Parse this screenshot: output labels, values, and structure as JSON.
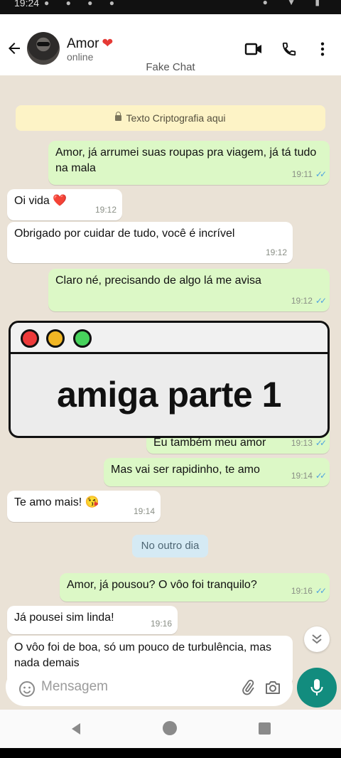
{
  "status_bar": {
    "time": "19:24"
  },
  "header": {
    "contact_name": "Amor",
    "name_emoji": "❤",
    "status": "online",
    "subtitle": "Fake Chat"
  },
  "encryption_notice": "Texto Criptografia aqui",
  "messages": [
    {
      "direction": "out",
      "text": "Amor, já arrumei suas roupas pra viagem, já tá tudo na mala",
      "time": "19:11"
    },
    {
      "direction": "in",
      "text": "Oi vida ❤️",
      "time": "19:12"
    },
    {
      "direction": "in",
      "text": "Obrigado por cuidar de tudo, você é incrível",
      "time": "19:12"
    },
    {
      "direction": "out",
      "text": "Claro né, precisando de algo lá me avisa",
      "time": "19:12"
    },
    {
      "direction": "out",
      "text": "Eu também meu amor",
      "time": "19:13"
    },
    {
      "direction": "out",
      "text": "Mas vai ser rapidinho, te amo",
      "time": "19:14"
    },
    {
      "direction": "in",
      "text": "Te amo mais! 😘",
      "time": "19:14"
    },
    {
      "direction": "out",
      "text": "Amor, já pousou? O vôo foi tranquilo?",
      "time": "19:16"
    },
    {
      "direction": "in",
      "text": "Já pousei sim linda!",
      "time": "19:16"
    },
    {
      "direction": "in",
      "text": "O vôo foi de boa, só um pouco de turbulência, mas nada demais",
      "time": ""
    }
  ],
  "day_divider": "No outro dia",
  "overlay": {
    "title": "amiga parte 1"
  },
  "composer": {
    "placeholder": "Mensagem"
  },
  "colors": {
    "outgoing_bubble": "#dcf8c6",
    "incoming_bubble": "#ffffff",
    "accent": "#128c7e",
    "read_ticks": "#4fa3e0",
    "encryption_banner": "#fdf3c6"
  }
}
